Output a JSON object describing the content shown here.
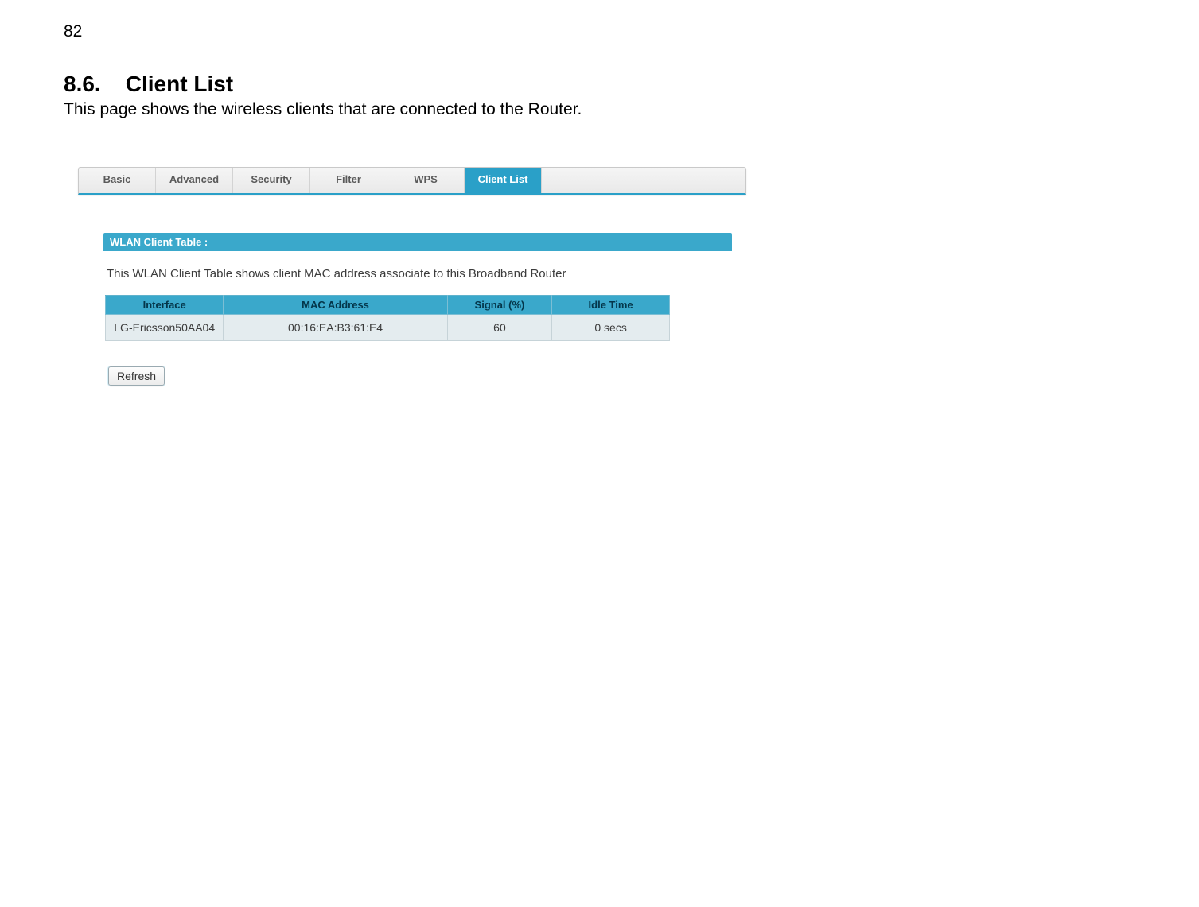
{
  "page_number": "82",
  "section": {
    "number": "8.6.",
    "title": "Client List",
    "description": "This page shows the wireless clients that are connected to the Router."
  },
  "tabs": {
    "items": [
      {
        "label": "Basic",
        "active": false
      },
      {
        "label": "Advanced",
        "active": false
      },
      {
        "label": "Security",
        "active": false
      },
      {
        "label": "Filter",
        "active": false
      },
      {
        "label": "WPS",
        "active": false
      },
      {
        "label": "Client List",
        "active": true
      }
    ]
  },
  "panel": {
    "title": "WLAN Client Table :",
    "note": "This WLAN Client Table shows client MAC address associate to this Broadband Router"
  },
  "table": {
    "headers": {
      "interface": "Interface",
      "mac": "MAC Address",
      "signal": "Signal (%)",
      "idle": "Idle Time"
    },
    "rows": [
      {
        "interface": "LG-Ericsson50AA04",
        "mac": "00:16:EA:B3:61:E4",
        "signal": "60",
        "idle": "0 secs"
      }
    ]
  },
  "buttons": {
    "refresh": "Refresh"
  }
}
